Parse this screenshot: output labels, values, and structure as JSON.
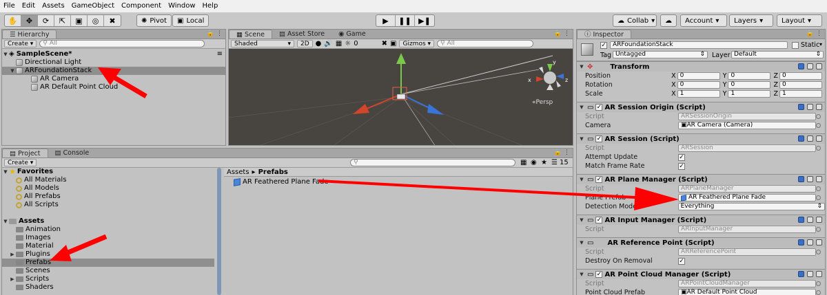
{
  "menu": [
    "File",
    "Edit",
    "Assets",
    "GameObject",
    "Component",
    "Window",
    "Help"
  ],
  "toolbar": {
    "pivot_label": "Pivot",
    "local_label": "Local",
    "collab_label": "Collab",
    "account_label": "Account",
    "layers_label": "Layers",
    "layout_label": "Layout"
  },
  "hierarchy": {
    "tab": "Hierarchy",
    "create": "Create",
    "search_placeholder": "All",
    "scene": "SampleScene*",
    "items": [
      "Directional Light",
      "ARFoundationStack",
      "AR Camera",
      "AR Default Point Cloud"
    ]
  },
  "scene_view": {
    "tabs": [
      "Scene",
      "Asset Store",
      "Game"
    ],
    "shading": "Shaded",
    "mode_2d": "2D",
    "fx_count": "0",
    "gizmos": "Gizmos",
    "search_placeholder": "All",
    "persp_label": "«Persp",
    "axis_x": "x",
    "axis_y": "y",
    "axis_z": "z"
  },
  "project": {
    "tabs": [
      "Project",
      "Console"
    ],
    "create": "Create",
    "favorites_label": "Favorites",
    "favorites": [
      "All Materials",
      "All Models",
      "All Prefabs",
      "All Scripts"
    ],
    "assets_label": "Assets",
    "folders": [
      "Animation",
      "Images",
      "Material",
      "Plugins",
      "Prefabs",
      "Scenes",
      "Scripts",
      "Shaders"
    ],
    "breadcrumb_root": "Assets",
    "breadcrumb_current": "Prefabs",
    "item": "AR Feathered Plane Fade",
    "layer_count": "15"
  },
  "inspector": {
    "tab": "Inspector",
    "object_name": "ARFoundationStack",
    "static_label": "Static",
    "tag_label": "Tag",
    "tag_value": "Untagged",
    "layer_label": "Layer",
    "layer_value": "Default",
    "transform": {
      "title": "Transform",
      "position_label": "Position",
      "rotation_label": "Rotation",
      "scale_label": "Scale",
      "position": [
        "0",
        "0",
        "0"
      ],
      "rotation": [
        "0",
        "0",
        "0"
      ],
      "scale": [
        "1",
        "1",
        "1"
      ]
    },
    "script_label": "Script",
    "session_origin": {
      "title": "AR Session Origin (Script)",
      "script": "ARSessionOrigin",
      "camera_label": "Camera",
      "camera_value": "AR Camera (Camera)"
    },
    "session": {
      "title": "AR Session (Script)",
      "script": "ARSession",
      "attempt_update_label": "Attempt Update",
      "match_frame_rate_label": "Match Frame Rate"
    },
    "plane_manager": {
      "title": "AR Plane Manager (Script)",
      "script": "ARPlaneManager",
      "plane_prefab_label": "Plane Prefab",
      "plane_prefab_value": "AR Feathered Plane Fade",
      "detection_mode_label": "Detection Mode",
      "detection_mode_value": "Everything"
    },
    "input_manager": {
      "title": "AR Input Manager (Script)",
      "script": "ARInputManager"
    },
    "reference_point": {
      "title": "AR Reference Point (Script)",
      "script": "ARReferencePoint",
      "destroy_label": "Destroy On Removal"
    },
    "point_cloud": {
      "title": "AR Point Cloud Manager (Script)",
      "script": "ARPointCloudManager",
      "prefab_label": "Point Cloud Prefab",
      "prefab_value": "AR Default Point Cloud"
    }
  },
  "colors": {
    "annotation_arrow": "#ff0000",
    "selection": "#8f8f8f",
    "scene_bg": "#48443f"
  }
}
